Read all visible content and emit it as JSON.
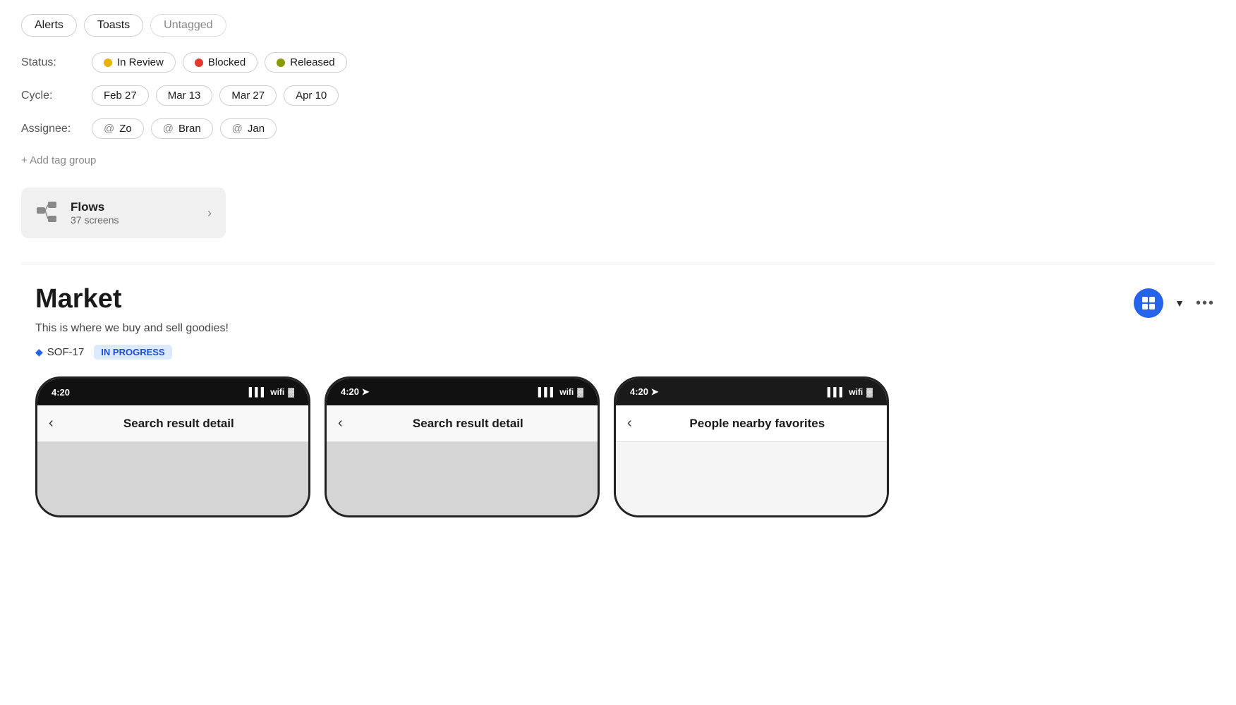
{
  "tags": [
    {
      "label": "Alerts",
      "muted": false
    },
    {
      "label": "Toasts",
      "muted": false
    },
    {
      "label": "Untagged",
      "muted": true
    }
  ],
  "filters": {
    "status": {
      "label": "Status:",
      "items": [
        {
          "label": "In Review",
          "dot": "yellow"
        },
        {
          "label": "Blocked",
          "dot": "red"
        },
        {
          "label": "Released",
          "dot": "olive"
        }
      ]
    },
    "cycle": {
      "label": "Cycle:",
      "items": [
        {
          "label": "Feb 27"
        },
        {
          "label": "Mar 13"
        },
        {
          "label": "Mar 27"
        },
        {
          "label": "Apr 10"
        }
      ]
    },
    "assignee": {
      "label": "Assignee:",
      "items": [
        {
          "label": "Zo"
        },
        {
          "label": "Bran"
        },
        {
          "label": "Jan"
        }
      ]
    }
  },
  "add_tag_group": "+ Add tag group",
  "flows": {
    "title": "Flows",
    "subtitle": "37 screens",
    "arrow": "›"
  },
  "market": {
    "title": "Market",
    "description": "This is where we buy and sell goodies!",
    "id": "SOF-17",
    "status_badge": "IN PROGRESS",
    "screens": [
      {
        "time": "4:20",
        "title": "Search result detail"
      },
      {
        "time": "4:20",
        "title": "Search result detail"
      },
      {
        "time": "4:20",
        "title": "People nearby favorites"
      }
    ]
  },
  "icons": {
    "plus": "+",
    "arrow_right": "›",
    "chevron_down": "▼",
    "more": "•••",
    "back": "‹"
  }
}
